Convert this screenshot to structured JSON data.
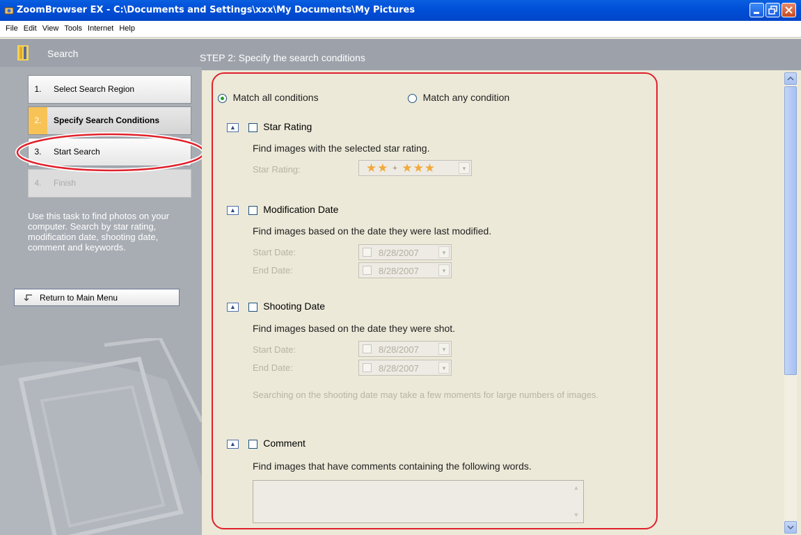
{
  "window": {
    "title": "ZoomBrowser EX  -  C:\\Documents and Settings\\xxx\\My Documents\\My Pictures"
  },
  "menu": [
    "File",
    "Edit",
    "View",
    "Tools",
    "Internet",
    "Help"
  ],
  "left": {
    "header": "Search",
    "steps": [
      {
        "num": "1.",
        "label": "Select Search Region"
      },
      {
        "num": "2.",
        "label": "Specify Search Conditions"
      },
      {
        "num": "3.",
        "label": "Start Search"
      },
      {
        "num": "4.",
        "label": "Finish"
      }
    ],
    "description": "Use this task to find photos on your computer. Search by star rating, modification date, shooting date, comment and keywords.",
    "return_label": "Return to Main Menu"
  },
  "main": {
    "header": "STEP 2: Specify the search conditions",
    "match_all": "Match all conditions",
    "match_any": "Match any condition",
    "star": {
      "title": "Star Rating",
      "desc": "Find images with the selected star rating.",
      "field_label": "Star Rating:",
      "stars_left": "★★",
      "plus": "+",
      "stars_right": "★★★"
    },
    "modified": {
      "title": "Modification Date",
      "desc": "Find images based on the date they were last modified.",
      "start_label": "Start Date:",
      "end_label": "End Date:",
      "start_value": "8/28/2007",
      "end_value": "8/28/2007"
    },
    "shooting": {
      "title": "Shooting Date",
      "desc": "Find images based on the date they were shot.",
      "start_label": "Start Date:",
      "end_label": "End Date:",
      "start_value": "8/28/2007",
      "end_value": "8/28/2007",
      "note": "Searching on the shooting date may take a few moments for large numbers of images."
    },
    "comment": {
      "title": "Comment",
      "desc": "Find images that have comments containing the following words."
    }
  }
}
